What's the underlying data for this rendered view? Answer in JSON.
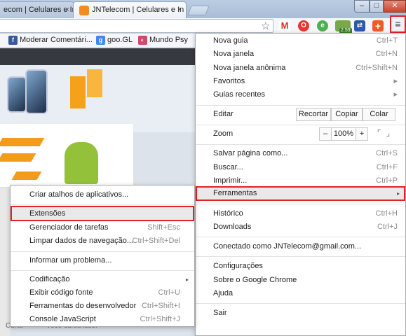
{
  "window": {
    "tabs": [
      {
        "label": "ecom | Celulares e In",
        "close": "×"
      },
      {
        "label": "JNTelecom | Celulares e In",
        "close": "×"
      }
    ],
    "controls": {
      "minimize": "–",
      "maximize": "□",
      "close": "✕"
    }
  },
  "toolbar": {
    "star": "☆",
    "menu_icon": "≡",
    "extensions": [
      {
        "name": "gmail",
        "glyph": "M"
      },
      {
        "name": "opera",
        "glyph": "O"
      },
      {
        "name": "evernote",
        "glyph": "e"
      },
      {
        "name": "android",
        "glyph": "",
        "badge": "2.59"
      },
      {
        "name": "arrows",
        "glyph": "⇄"
      },
      {
        "name": "plus",
        "glyph": "+"
      }
    ]
  },
  "bookmarks": [
    {
      "label": "",
      "icon_color": "#4a6fb3"
    },
    {
      "label": "Moderar Comentári...",
      "icon": "f",
      "icon_color": "#3b5998"
    },
    {
      "label": "goo.GL",
      "icon": "g",
      "icon_color": "#4285f4"
    },
    {
      "label": "Mundo Psy",
      "icon": "◐",
      "icon_color": "#d04b6b"
    }
  ],
  "page": {
    "footer_left": "Curta",
    "footer_text": "Você curtiu isso."
  },
  "main_menu": {
    "items": [
      {
        "label": "Nova guia",
        "shortcut": "Ctrl+T"
      },
      {
        "label": "Nova janela",
        "shortcut": "Ctrl+N"
      },
      {
        "label": "Nova janela anônima",
        "shortcut": "Ctrl+Shift+N"
      },
      {
        "label": "Favoritos",
        "shortcut": "▸"
      },
      {
        "label": "Guias recentes",
        "shortcut": "▸"
      },
      {
        "label": "Editar",
        "shortcut": ""
      },
      {
        "label": "Zoom",
        "shortcut": ""
      },
      {
        "label": "Salvar página como...",
        "shortcut": "Ctrl+S"
      },
      {
        "label": "Buscar...",
        "shortcut": "Ctrl+F"
      },
      {
        "label": "Imprimir...",
        "shortcut": "Ctrl+P"
      },
      {
        "label": "Ferramentas",
        "shortcut": "▸"
      },
      {
        "label": "Histórico",
        "shortcut": "Ctrl+H"
      },
      {
        "label": "Downloads",
        "shortcut": "Ctrl+J"
      },
      {
        "label": "Conectado como JNTelecom@gmail.com...",
        "shortcut": ""
      },
      {
        "label": "Configurações",
        "shortcut": ""
      },
      {
        "label": "Sobre o Google Chrome",
        "shortcut": ""
      },
      {
        "label": "Ajuda",
        "shortcut": ""
      },
      {
        "label": "Sair",
        "shortcut": ""
      }
    ],
    "edit_buttons": {
      "cut": "Recortar",
      "copy": "Copiar",
      "paste": "Colar"
    },
    "zoom": {
      "minus": "–",
      "value": "100%",
      "plus": "+",
      "fullscreen": "⌜ ⌟"
    }
  },
  "sub_menu": {
    "items": [
      {
        "label": "Criar atalhos de aplicativos...",
        "shortcut": ""
      },
      {
        "label": "Extensões",
        "shortcut": ""
      },
      {
        "label": "Gerenciador de tarefas",
        "shortcut": "Shift+Esc"
      },
      {
        "label": "Limpar dados de navegação...",
        "shortcut": "Ctrl+Shift+Del"
      },
      {
        "label": "Informar um problema...",
        "shortcut": ""
      },
      {
        "label": "Codificação",
        "shortcut": "▸"
      },
      {
        "label": "Exibir código fonte",
        "shortcut": "Ctrl+U"
      },
      {
        "label": "Ferramentas do desenvolvedor",
        "shortcut": "Ctrl+Shift+I"
      },
      {
        "label": "Console JavaScript",
        "shortcut": "Ctrl+Shift+J"
      }
    ]
  },
  "colors": {
    "highlight_border": "#e0222a",
    "menu_hover": "#e9e9e9",
    "brand_orange": "#f5a21a"
  }
}
